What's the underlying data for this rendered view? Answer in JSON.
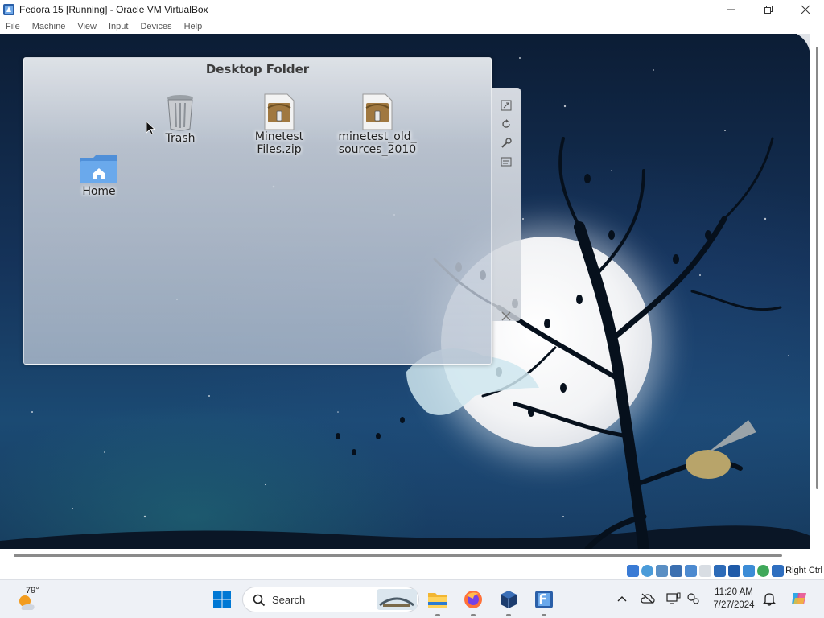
{
  "window": {
    "title": "Fedora 15 [Running] - Oracle VM VirtualBox",
    "controls": [
      "minimize-icon",
      "restore-icon",
      "close-icon"
    ]
  },
  "menubar": {
    "items": [
      "File",
      "Machine",
      "View",
      "Input",
      "Devices",
      "Help"
    ]
  },
  "guest": {
    "folder_widget": {
      "title": "Desktop Folder",
      "icons": [
        {
          "label_line1": "Trash",
          "label_line2": "",
          "icon": "trash-icon"
        },
        {
          "label_line1": "Minetest",
          "label_line2": "Files.zip",
          "icon": "archive-icon"
        },
        {
          "label_line1": "minetest_old_",
          "label_line2": "sources_2010",
          "icon": "archive-icon"
        },
        {
          "label_line1": "Home",
          "label_line2": "",
          "icon": "home-folder-icon"
        }
      ],
      "side_tools": [
        "resize-icon",
        "rotate-icon",
        "settings-wrench-icon",
        "activity-icon"
      ]
    }
  },
  "vbox_status": {
    "host_key": "Right Ctrl",
    "icons": [
      "hard-disk-icon",
      "optical-drive-icon",
      "audio-icon",
      "network-icon",
      "usb-icon",
      "shared-folders-icon",
      "display-icon",
      "video-capture-icon",
      "recording-icon",
      "cpu-icon",
      "arrow-down-icon"
    ]
  },
  "taskbar": {
    "weather_temp": "79°",
    "search_placeholder": "Search",
    "clock_time": "11:20 AM",
    "clock_date": "7/27/2024",
    "pinned": [
      "start-icon",
      "file-explorer-icon",
      "firefox-icon",
      "virtualbox-icon",
      "virtualbox-vm-icon"
    ]
  },
  "colors": {
    "sky_top": "#0c1d35",
    "sky_bottom": "#1b4a73",
    "windows_accent": "#0078d4"
  }
}
